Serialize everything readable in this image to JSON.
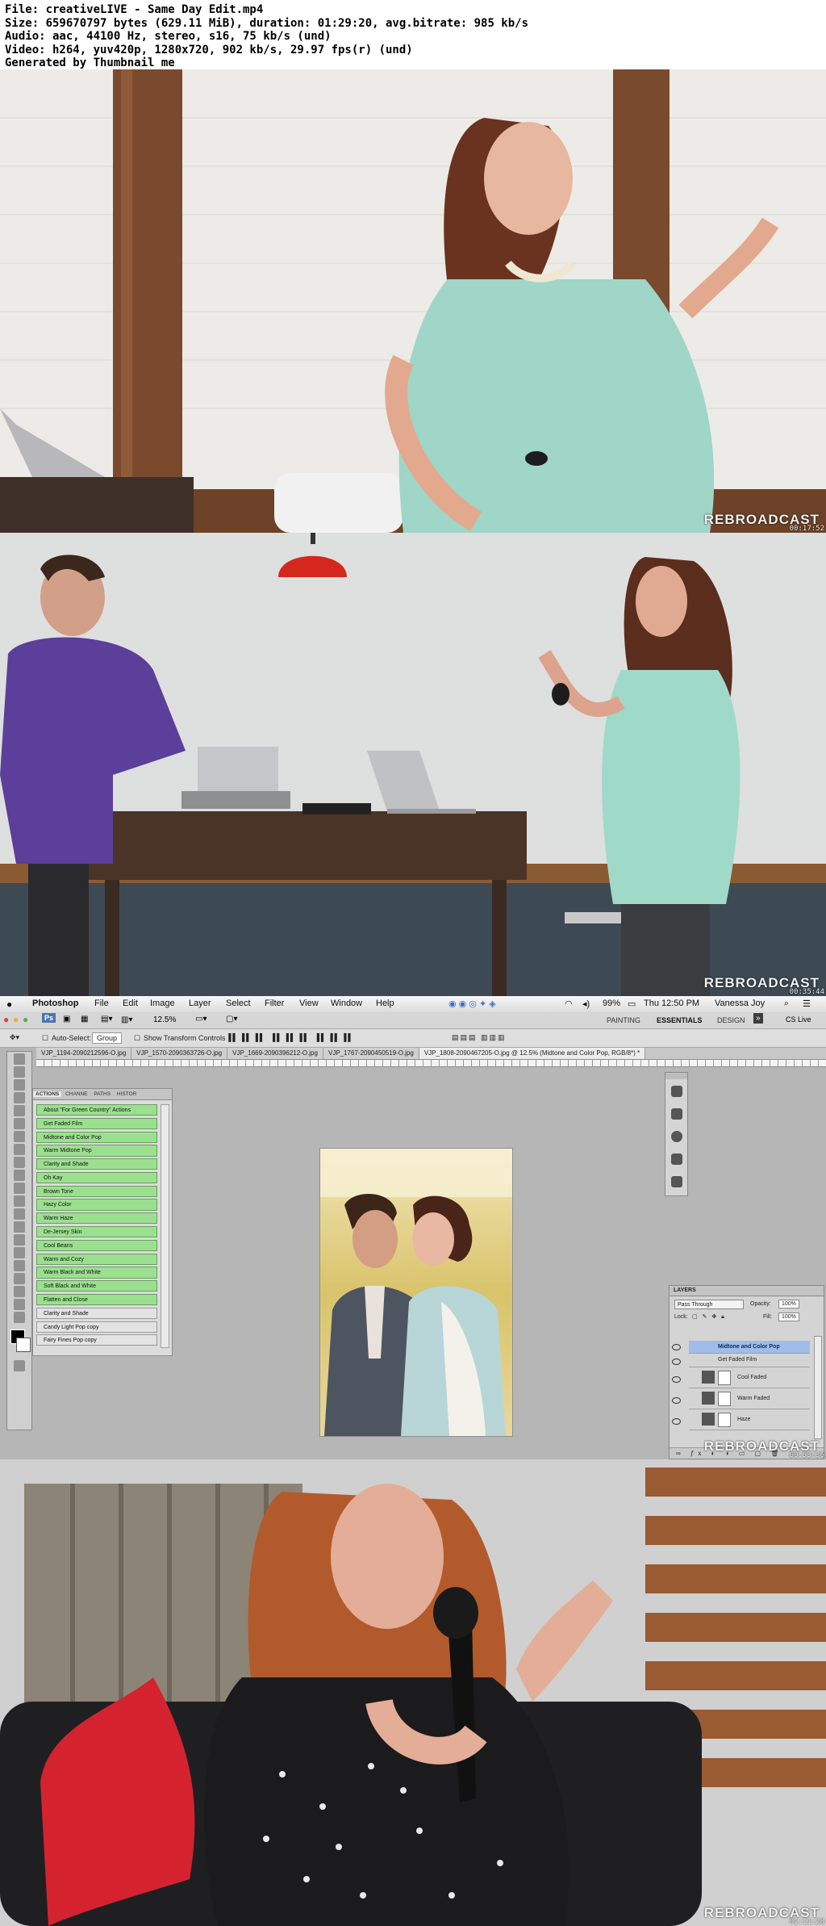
{
  "info": {
    "file": "File: creativeLIVE - Same Day Edit.mp4",
    "size": "Size: 659670797 bytes (629.11 MiB), duration: 01:29:20, avg.bitrate: 985 kb/s",
    "audio": "Audio: aac, 44100 Hz, stereo, s16, 75 kb/s (und)",
    "video": "Video: h264, yuv420p, 1280x720, 902 kb/s, 29.97 fps(r) (und)",
    "generator": "Generated by Thumbnail me"
  },
  "frames": [
    {
      "watermark": "REBROADCAST",
      "timestamp": "00:17:52"
    },
    {
      "watermark": "REBROADCAST",
      "timestamp": "00:35:44"
    },
    {
      "watermark": "REBROADCAST",
      "timestamp": "00:53:36"
    },
    {
      "watermark": "REBROADCAST",
      "timestamp": "01:11:28"
    }
  ],
  "photoshop": {
    "menu": [
      "Photoshop",
      "File",
      "Edit",
      "Image",
      "Layer",
      "Select",
      "Filter",
      "View",
      "Window",
      "Help"
    ],
    "status_battery": "99%",
    "clock": "Thu 12:50 PM",
    "user": "Vanessa Joy",
    "zoom": "12.5%",
    "workspaces": [
      "PAINTING",
      "ESSENTIALS",
      "DESIGN"
    ],
    "cs_live": "CS Live",
    "options": {
      "auto_select": "Auto-Select:",
      "group": "Group",
      "show_transform": "Show Transform Controls"
    },
    "doc_tabs": [
      "VJP_1194-2090212596-O.jpg",
      "VJP_1570-2090363726-O.jpg",
      "VJP_1669-2090396212-O.jpg",
      "VJP_1767-2090450519-O.jpg",
      "VJP_1808-2090467205-O.jpg @ 12.5% (Midtone and Color Pop, RGB/8*) *"
    ],
    "actions_panel": {
      "tabs": [
        "ACTIONS",
        "CHANNE",
        "PATHS",
        "HISTOR"
      ],
      "items": [
        "About \"For Green Country\" Actions",
        "Get Faded Film",
        "Midtone and Color Pop",
        "Warm Midtone Pop",
        "Clarity and Shade",
        "Oh Kay",
        "Brown Tone",
        "Hazy Color",
        "Warm Haze",
        "De-Jersey Skin",
        "Cool Beans",
        "Warm and Cozy",
        "Warm Black and White",
        "Soft Black and White",
        "Flatten and Close",
        "Clarity and Shade",
        "Candy Light Pop copy",
        "Fairy Fines Pop copy"
      ]
    },
    "layers_panel": {
      "title": "LAYERS",
      "blend_mode": "Pass Through",
      "opacity_label": "Opacity:",
      "opacity": "100%",
      "lock_label": "Lock:",
      "fill_label": "Fill:",
      "fill": "100%",
      "layers": [
        "Midtone and Color Pop",
        "Get Faded Film",
        "Cool Faded",
        "Warm Faded",
        "Haze"
      ]
    }
  }
}
